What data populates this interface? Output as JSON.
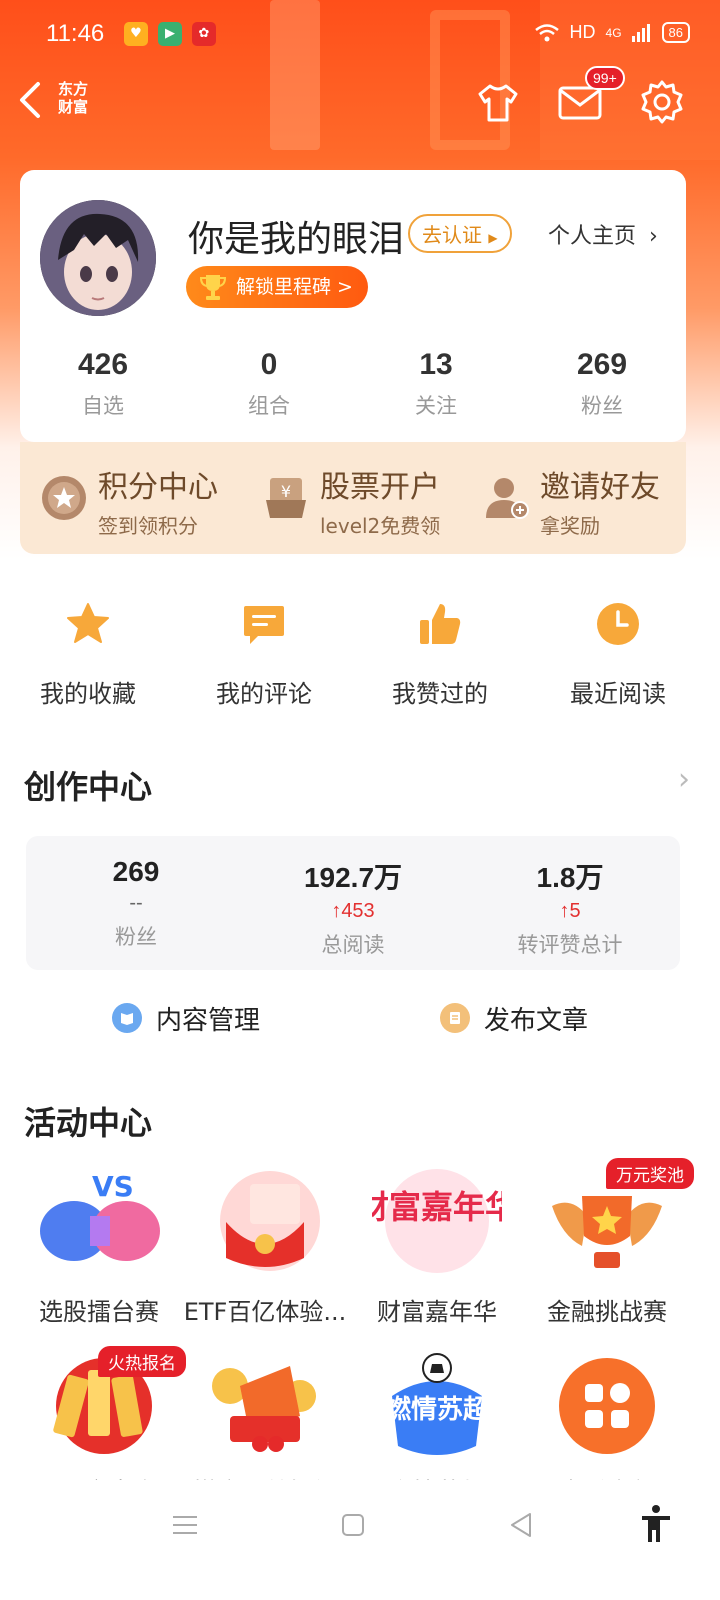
{
  "status_bar": {
    "time": "11:46",
    "network": "HD",
    "signal": "4G",
    "battery": "86"
  },
  "nav": {
    "brand": "东方财富",
    "mail_badge": "99+"
  },
  "profile": {
    "username": "你是我的眼泪",
    "verify_label": "去认证",
    "home_link": "个人主页",
    "milestone_label": "解锁里程碑 >",
    "stats": [
      {
        "value": "426",
        "label": "自选"
      },
      {
        "value": "0",
        "label": "组合"
      },
      {
        "value": "13",
        "label": "关注"
      },
      {
        "value": "269",
        "label": "粉丝"
      }
    ]
  },
  "band": [
    {
      "title": "积分中心",
      "sub": "签到领积分",
      "icon": "star-coin-icon"
    },
    {
      "title": "股票开户",
      "sub": "level2免费领",
      "icon": "yen-box-icon"
    },
    {
      "title": "邀请好友",
      "sub": "拿奖励",
      "icon": "add-user-icon"
    }
  ],
  "quick_actions": [
    {
      "label": "我的收藏",
      "icon": "star-icon"
    },
    {
      "label": "我的评论",
      "icon": "comment-icon"
    },
    {
      "label": "我赞过的",
      "icon": "thumbs-up-icon"
    },
    {
      "label": "最近阅读",
      "icon": "clock-icon"
    }
  ],
  "creator": {
    "title": "创作中心",
    "stats": [
      {
        "value": "269",
        "delta": "--",
        "label": "粉丝"
      },
      {
        "value": "192.7万",
        "delta": "↑453",
        "label": "总阅读"
      },
      {
        "value": "1.8万",
        "delta": "↑5",
        "label": "转评赞总计"
      }
    ],
    "manage_label": "内容管理",
    "publish_label": "发布文章"
  },
  "activities": {
    "title": "活动中心",
    "items": [
      {
        "label": "选股擂台赛",
        "tag": ""
      },
      {
        "label": "ETF百亿体验...",
        "tag": ""
      },
      {
        "label": "财富嘉年华",
        "tag": ""
      },
      {
        "label": "金融挑战赛",
        "tag": "万元奖池"
      },
      {
        "label": "ETF实盘赛",
        "tag": "火热报名"
      },
      {
        "label": "攒金豆兑好礼",
        "tag": ""
      },
      {
        "label": "燃情苏超",
        "tag": ""
      },
      {
        "label": "查看全部",
        "tag": ""
      }
    ],
    "graphic_text": {
      "vs": "VS",
      "carnival": "财富嘉年华",
      "soccer": "燃情苏超"
    }
  },
  "colors": {
    "accent": "#ff5a1a",
    "gold": "#f7a83a",
    "red": "#e5202a"
  }
}
